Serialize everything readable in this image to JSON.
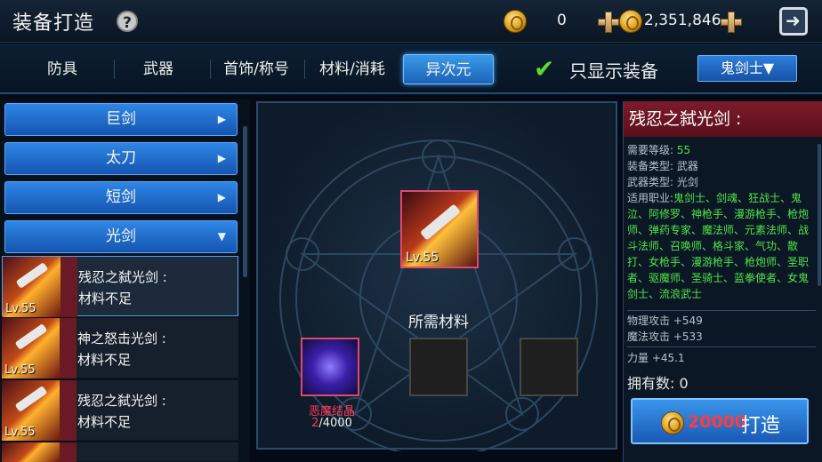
{
  "header": {
    "title": "装备打造",
    "help": "?",
    "currency1": "0",
    "currency2": "2,351,846"
  },
  "tabs": [
    "防具",
    "武器",
    "首饰/称号",
    "材料/消耗",
    "异次元"
  ],
  "active_tab": "异次元",
  "filter": {
    "label": "只显示装备",
    "class_select": "鬼剑士▼"
  },
  "categories": [
    {
      "label": "巨剑",
      "arrow": "▶"
    },
    {
      "label": "太刀",
      "arrow": "▶"
    },
    {
      "label": "短剑",
      "arrow": "▶"
    },
    {
      "label": "光剑",
      "arrow": "▼"
    }
  ],
  "items": [
    {
      "name": "残忍之弑光剑 :",
      "status": "材料不足",
      "level": "Lv.55"
    },
    {
      "name": "神之怒击光剑 :",
      "status": "材料不足",
      "level": "Lv.55"
    },
    {
      "name": "残忍之弑光剑 :",
      "status": "材料不足",
      "level": "Lv.55"
    }
  ],
  "center": {
    "item_level": "Lv.55",
    "required_title": "所需材料",
    "material": {
      "name": "恶魔结晶",
      "have": "2",
      "need": "/4000"
    }
  },
  "detail": {
    "title": "残忍之弑光剑 :",
    "req_level_label": "需要等级:",
    "req_level": "55",
    "equip_type_label": "装备类型:",
    "equip_type": "武器",
    "weapon_type_label": "武器类型:",
    "weapon_type": "光剑",
    "jobs_label": "适用职业:",
    "jobs": "鬼剑士、剑魂、狂战士、鬼泣、阿修罗、神枪手、漫游枪手、枪炮师、弹药专家、魔法师、元素法师、战斗法师、召唤师、格斗家、气功、散打、女枪手、漫游枪手、枪炮师、圣职者、驱魔师、圣骑士、蓝拳使者、女鬼剑士、流浪武士",
    "phys_atk": "物理攻击 +549",
    "mag_atk": "魔法攻击 +533",
    "strength": "力量 +45.1",
    "own": "拥有数:  0",
    "craft_cost": "20000",
    "craft_label": "打造"
  }
}
